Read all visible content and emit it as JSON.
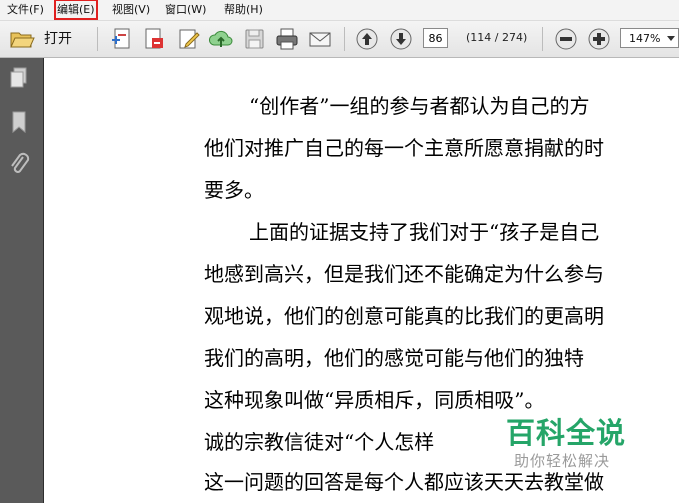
{
  "menu": {
    "items": [
      "文件(F)",
      "编辑(E)",
      "视图(V)",
      "窗口(W)",
      "帮助(H)"
    ]
  },
  "toolbar": {
    "open_label": "打开",
    "page_number": "86",
    "page_count": "(114 / 274)",
    "zoom": "147%"
  },
  "icons": {
    "toolbar": [
      "folder-open-icon",
      "create-icon",
      "export-icon",
      "edit-icon",
      "upload-icon",
      "save-icon",
      "print-icon",
      "email-icon",
      "page-up-icon",
      "page-down-icon",
      "zoom-out-icon",
      "zoom-in-icon"
    ],
    "left_panel": [
      "pages-icon",
      "bookmarks-icon",
      "attachments-icon"
    ]
  },
  "document": {
    "lines": [
      "“创作者”一组的参与者都认为自己的方",
      "他们对推广自己的每一个主意所愿意捐献的时",
      "要多。",
      "上面的证据支持了我们对于“孩子是自己",
      "地感到高兴，但是我们还不能确定为什么参与",
      "观地说，他们的创意可能真的比我们的更高明",
      "我们的高明，他们的感觉可能与他们的独特",
      "这种现象叫做“异质相斥，同质相吸”。",
      "诚的宗教信徒对“个人怎样",
      "这一问题的回答是每个人都应该天天去教堂做"
    ]
  },
  "watermark": {
    "title": "百科全说",
    "subtitle": "助你轻松解决"
  },
  "colors": {
    "highlight_box": "#e02020",
    "watermark_green": "#1aa160",
    "panel_gray": "#5a5a5a"
  }
}
